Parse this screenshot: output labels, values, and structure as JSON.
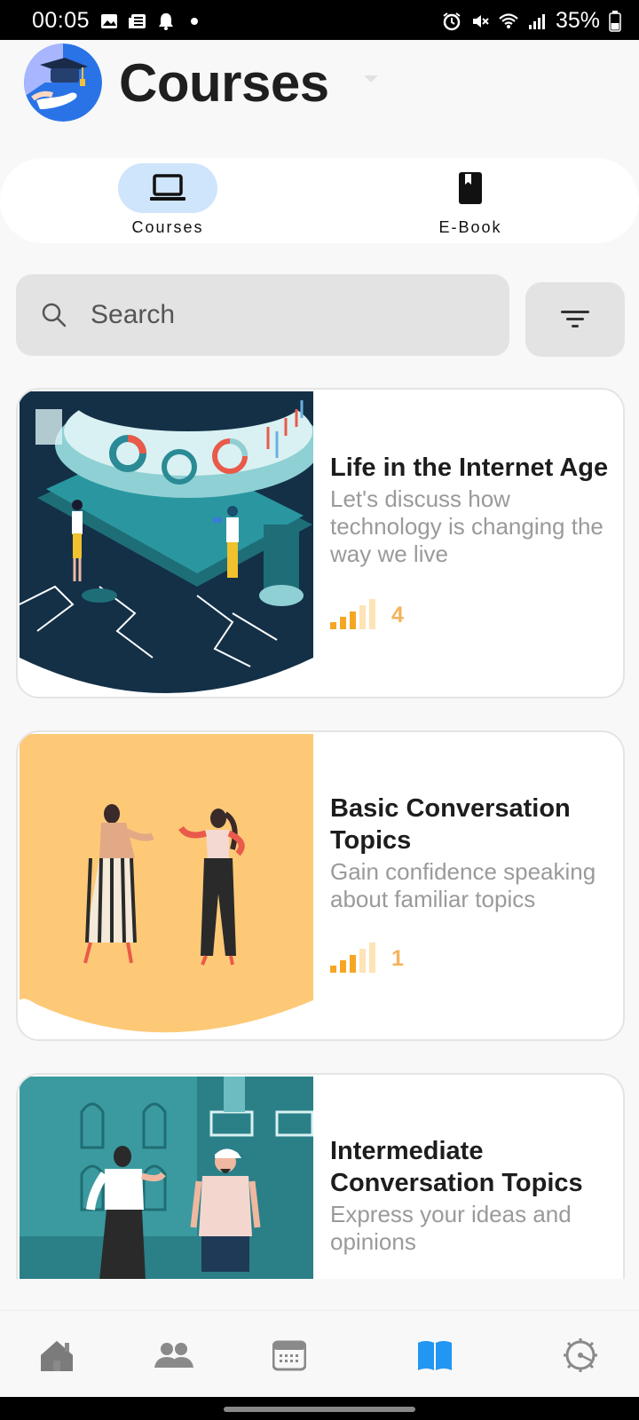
{
  "status_bar": {
    "time": "00:05",
    "battery": "35%"
  },
  "header": {
    "title": "Courses"
  },
  "tabs": [
    {
      "label": "Courses",
      "icon": "laptop-icon",
      "active": true
    },
    {
      "label": "E-Book",
      "icon": "book-icon",
      "active": false
    }
  ],
  "search": {
    "placeholder": "Search"
  },
  "courses": [
    {
      "title": "Life in the Internet Age",
      "description": "Let's discuss how technology is changing the way we live",
      "level": "4"
    },
    {
      "title": "Basic Conversation Topics",
      "description": "Gain confidence speaking about familiar topics",
      "level": "1"
    },
    {
      "title": "Intermediate Conversation Topics",
      "description": "Express your ideas and opinions"
    }
  ],
  "bottom_nav": [
    {
      "icon": "home-icon",
      "active": false
    },
    {
      "icon": "people-icon",
      "active": false
    },
    {
      "icon": "calendar-icon",
      "active": false
    },
    {
      "icon": "open-book-icon",
      "active": true
    },
    {
      "icon": "settings-gear-icon",
      "active": false
    }
  ],
  "colors": {
    "accent": "#2196f3",
    "tab_active_bg": "#cfe5fb",
    "level_orange": "#f5a623",
    "text_muted": "#9a9a9a"
  }
}
